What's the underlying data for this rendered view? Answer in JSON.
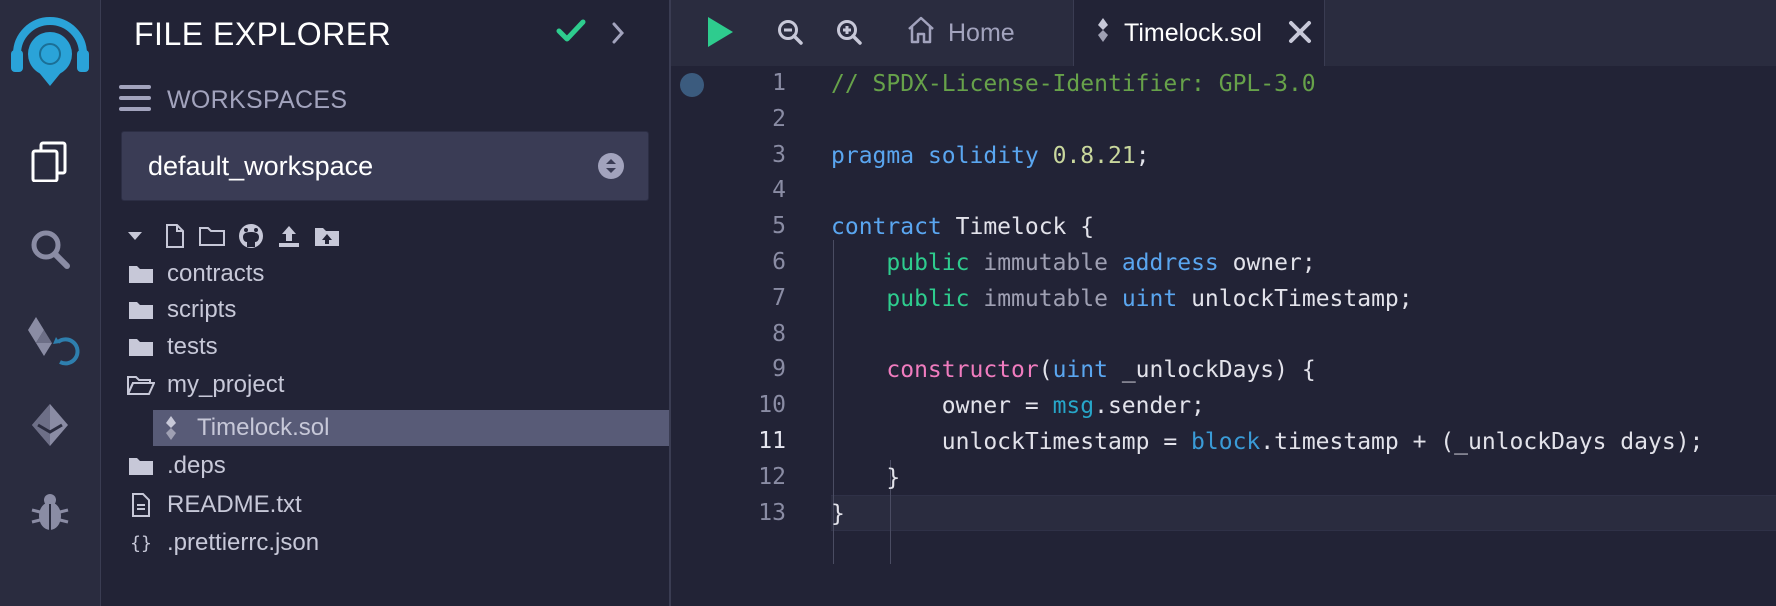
{
  "sidebar": {
    "title": "FILE EXPLORER",
    "workspaces_label": "WORKSPACES",
    "workspace_selected": "default_workspace",
    "tree": [
      {
        "label": "contracts",
        "type": "folder"
      },
      {
        "label": "scripts",
        "type": "folder"
      },
      {
        "label": "tests",
        "type": "folder"
      },
      {
        "label": "my_project",
        "type": "folder-open"
      },
      {
        "label": "Timelock.sol",
        "type": "solidity-file",
        "selected": true
      },
      {
        "label": ".deps",
        "type": "folder"
      },
      {
        "label": "README.txt",
        "type": "text-file"
      },
      {
        "label": ".prettierrc.json",
        "type": "json-file"
      }
    ]
  },
  "tabs": {
    "home_label": "Home",
    "active_label": "Timelock.sol"
  },
  "editor": {
    "current_line": 11,
    "line_numbers": [
      "1",
      "2",
      "3",
      "4",
      "5",
      "6",
      "7",
      "8",
      "9",
      "10",
      "11",
      "12",
      "13"
    ],
    "lines": [
      [
        {
          "t": "// SPDX-License-Identifier: GPL-3.0",
          "c": "comment"
        }
      ],
      [],
      [
        {
          "t": "pragma",
          "c": "kw"
        },
        {
          "t": " ",
          "c": ""
        },
        {
          "t": "solidity",
          "c": "kw"
        },
        {
          "t": " ",
          "c": ""
        },
        {
          "t": "0.8.21",
          "c": "num"
        },
        {
          "t": ";",
          "c": ""
        }
      ],
      [],
      [
        {
          "t": "contract",
          "c": "kw"
        },
        {
          "t": " Timelock {",
          "c": ""
        }
      ],
      [
        {
          "t": "    ",
          "c": ""
        },
        {
          "t": "public",
          "c": "mod"
        },
        {
          "t": " ",
          "c": ""
        },
        {
          "t": "immutable",
          "c": "dim"
        },
        {
          "t": " ",
          "c": ""
        },
        {
          "t": "address",
          "c": "type"
        },
        {
          "t": " owner;",
          "c": ""
        }
      ],
      [
        {
          "t": "    ",
          "c": ""
        },
        {
          "t": "public",
          "c": "mod"
        },
        {
          "t": " ",
          "c": ""
        },
        {
          "t": "immutable",
          "c": "dim"
        },
        {
          "t": " ",
          "c": ""
        },
        {
          "t": "uint",
          "c": "type"
        },
        {
          "t": " unlockTimestamp;",
          "c": ""
        }
      ],
      [],
      [
        {
          "t": "    ",
          "c": ""
        },
        {
          "t": "constructor",
          "c": "ctor"
        },
        {
          "t": "(",
          "c": ""
        },
        {
          "t": "uint",
          "c": "type"
        },
        {
          "t": " _unlockDays) {",
          "c": ""
        }
      ],
      [
        {
          "t": "        owner = ",
          "c": ""
        },
        {
          "t": "msg",
          "c": "glob"
        },
        {
          "t": ".sender;",
          "c": ""
        }
      ],
      [
        {
          "t": "        unlockTimestamp = ",
          "c": ""
        },
        {
          "t": "block",
          "c": "blue"
        },
        {
          "t": ".timestamp + (_unlockDays days);",
          "c": ""
        }
      ],
      [
        {
          "t": "    }",
          "c": ""
        }
      ],
      [
        {
          "t": "}",
          "c": ""
        }
      ]
    ]
  },
  "colors": {
    "background": "#222336",
    "rail": "#2a2c3f",
    "accent_green": "#2ecc8e",
    "selected_row": "#585b77"
  }
}
